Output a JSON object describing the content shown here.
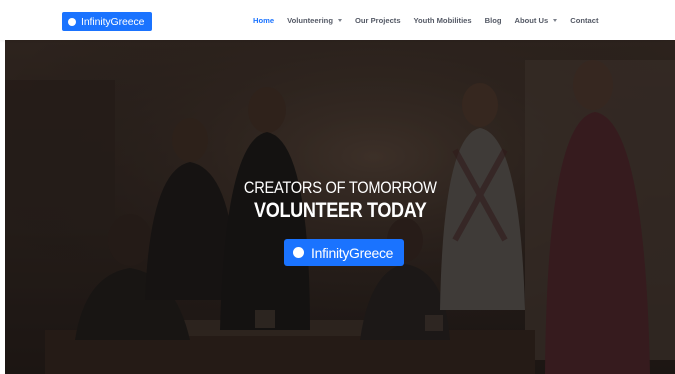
{
  "header": {
    "logo_text": "InfinityGreece",
    "nav": [
      {
        "label": "Home",
        "active": true,
        "dropdown": false
      },
      {
        "label": "Volunteering",
        "active": false,
        "dropdown": true
      },
      {
        "label": "Our Projects",
        "active": false,
        "dropdown": false
      },
      {
        "label": "Youth Mobilities",
        "active": false,
        "dropdown": false
      },
      {
        "label": "Blog",
        "active": false,
        "dropdown": false
      },
      {
        "label": "About Us",
        "active": false,
        "dropdown": true
      },
      {
        "label": "Contact",
        "active": false,
        "dropdown": false
      }
    ]
  },
  "hero": {
    "line1": "CREATORS OF TOMORROW",
    "line2": "VOLUNTEER TODAY",
    "badge_text": "InfinityGreece"
  },
  "colors": {
    "brand": "#1a73ff",
    "nav_text": "#555a66",
    "nav_active": "#1a73ff"
  },
  "icons": {
    "logo": "circle-dot-icon",
    "dropdown": "caret-down-icon"
  }
}
